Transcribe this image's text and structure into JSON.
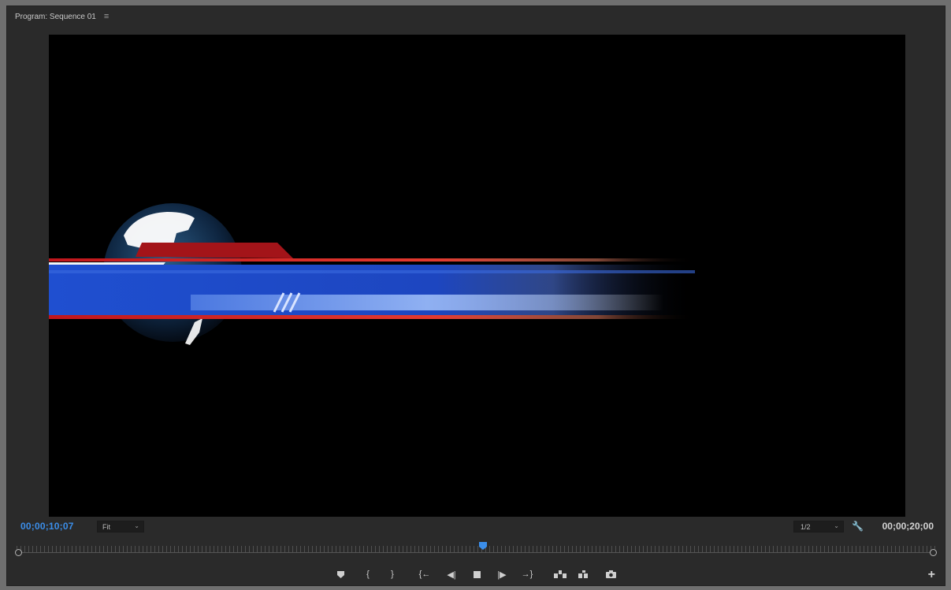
{
  "panel": {
    "title": "Program: Sequence 01",
    "menu_icon": "hamburger-menu-icon"
  },
  "timecodes": {
    "current": "00;00;10;07",
    "duration": "00;00;20;00"
  },
  "controls": {
    "fit_value": "Fit",
    "resolution_value": "1/2",
    "playhead_fraction": 0.508
  },
  "transport_icons": [
    "add-marker-icon",
    "mark-in-icon",
    "mark-out-icon",
    "go-to-in-icon",
    "step-back-icon",
    "stop-icon",
    "step-forward-icon",
    "go-to-out-icon",
    "lift-icon",
    "extract-icon",
    "export-frame-icon"
  ],
  "colors": {
    "timecode_current": "#3b8eea",
    "panel_bg": "#2a2a2a",
    "lower_third_blue": "#1f4fd0",
    "lower_third_red": "#b3151a"
  }
}
